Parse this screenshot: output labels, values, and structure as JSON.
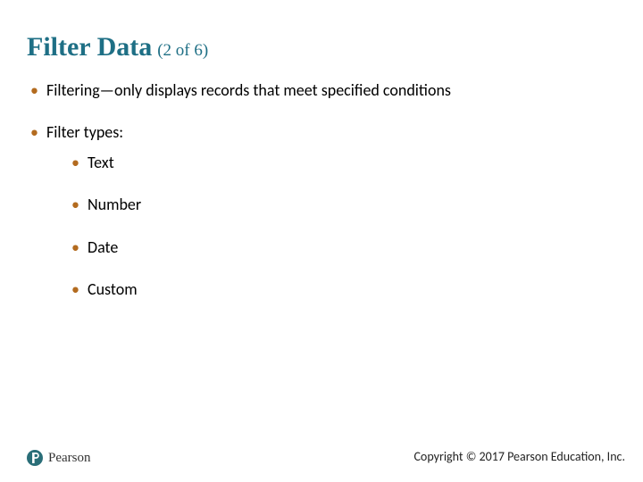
{
  "title": {
    "main": "Filter Data",
    "sub": "(2 of 6)"
  },
  "bullets": {
    "item1": "Filtering—only displays records that meet specified conditions",
    "item2": "Filter types:",
    "sub": {
      "s1": "Text",
      "s2": "Number",
      "s3": "Date",
      "s4": "Custom"
    }
  },
  "footer": {
    "brand": "Pearson",
    "copyright": "Copyright © 2017 Pearson Education, Inc."
  }
}
